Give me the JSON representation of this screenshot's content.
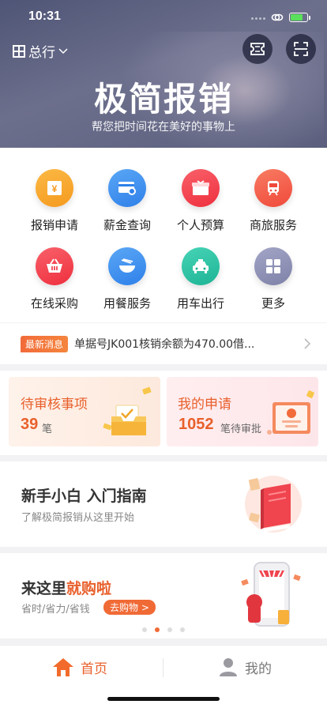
{
  "status_bar": {
    "time": "10:31"
  },
  "header": {
    "branch": "总行",
    "title": "极简报销",
    "subtitle": "帮您把时间花在美好的事物上"
  },
  "icons": {
    "ticket": "ticket-icon",
    "scan": "scan-icon"
  },
  "grid": [
    {
      "label": "报销申请",
      "icon": "reimburse-icon",
      "color": "#f9a325"
    },
    {
      "label": "薪金查询",
      "icon": "salary-icon",
      "color": "#3a8ff0"
    },
    {
      "label": "个人预算",
      "icon": "budget-icon",
      "color": "#f2414d"
    },
    {
      "label": "商旅服务",
      "icon": "train-icon",
      "color": "#f35b45"
    },
    {
      "label": "在线采购",
      "icon": "basket-icon",
      "color": "#f2414d"
    },
    {
      "label": "用餐服务",
      "icon": "bowl-icon",
      "color": "#3a8ff0"
    },
    {
      "label": "用车出行",
      "icon": "taxi-icon",
      "color": "#26c2a5"
    },
    {
      "label": "更多",
      "icon": "more-grid-icon",
      "color": "#8c8fb4"
    }
  ],
  "news": {
    "tag": "最新消息",
    "text": "单据号JK001核销余额为470.00借..."
  },
  "cards": {
    "pending": {
      "title": "待审核事项",
      "count": "39",
      "unit": "笔"
    },
    "mine": {
      "title": "我的申请",
      "count": "1052",
      "unit": "笔待审批"
    }
  },
  "guide": {
    "title": "新手小白 入门指南",
    "subtitle": "了解极简报销从这里开始"
  },
  "shop": {
    "title_prefix": "来这里",
    "title_highlight": "就购啦",
    "subtitle": "省时/省力/省钱",
    "button": "去购物 >"
  },
  "carousel": {
    "pages": 4,
    "active": 2
  },
  "tabbar": {
    "home": "首页",
    "me": "我的"
  },
  "colors": {
    "accent": "#e8602c",
    "hero": "#5b5f7d"
  }
}
